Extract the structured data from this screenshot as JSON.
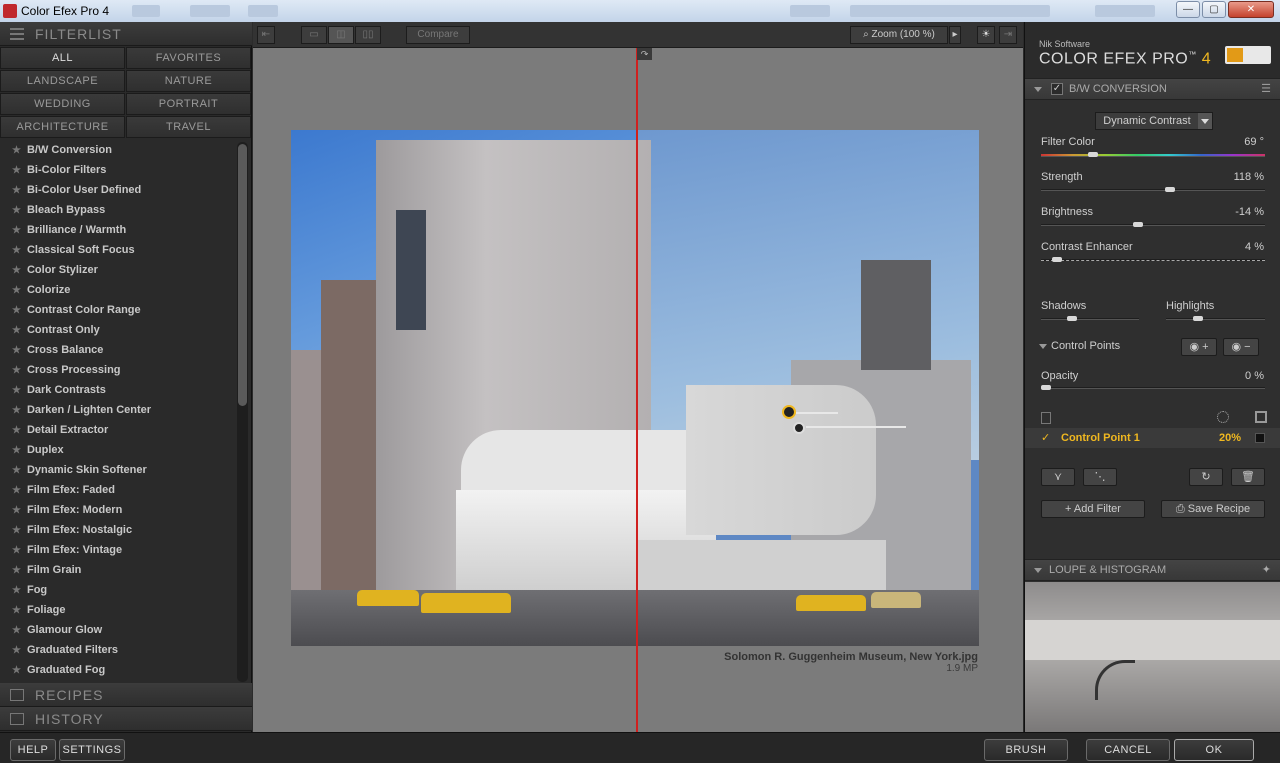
{
  "window": {
    "title": "Color Efex Pro 4",
    "buttons": {
      "minimize": "—",
      "maximize": "▢",
      "close": "✕"
    }
  },
  "left": {
    "filterlist_header": "FILTERLIST",
    "categories": [
      [
        "ALL",
        "FAVORITES"
      ],
      [
        "LANDSCAPE",
        "NATURE"
      ],
      [
        "WEDDING",
        "PORTRAIT"
      ],
      [
        "ARCHITECTURE",
        "TRAVEL"
      ]
    ],
    "filters": [
      "B/W Conversion",
      "Bi-Color Filters",
      "Bi-Color User Defined",
      "Bleach Bypass",
      "Brilliance / Warmth",
      "Classical Soft Focus",
      "Color Stylizer",
      "Colorize",
      "Contrast Color Range",
      "Contrast Only",
      "Cross Balance",
      "Cross Processing",
      "Dark Contrasts",
      "Darken / Lighten Center",
      "Detail Extractor",
      "Duplex",
      "Dynamic Skin Softener",
      "Film Efex: Faded",
      "Film Efex: Modern",
      "Film Efex: Nostalgic",
      "Film Efex: Vintage",
      "Film Grain",
      "Fog",
      "Foliage",
      "Glamour Glow",
      "Graduated Filters",
      "Graduated Fog"
    ],
    "recipes_header": "RECIPES",
    "history_header": "HISTORY",
    "star": "★"
  },
  "toolbar": {
    "compare": "Compare",
    "zoom": "Zoom (100 %)",
    "zoom_arrow": "▸"
  },
  "canvas": {
    "filename": "Solomon R. Guggenheim Museum, New York.jpg",
    "size": "1.9 MP"
  },
  "right": {
    "brand_small": "Nik Software",
    "brand_name": "COLOR EFEX PRO",
    "brand_tm": "™",
    "brand_version": "4",
    "section_title": "B/W CONVERSION",
    "method": "Dynamic Contrast",
    "sliders": [
      {
        "label": "Filter Color",
        "value": "69",
        "unit": "°",
        "fraction": 0.22
      },
      {
        "label": "Strength",
        "value": "118",
        "unit": "%",
        "fraction": 0.58
      },
      {
        "label": "Brightness",
        "value": "-14",
        "unit": "%",
        "fraction": 0.43
      },
      {
        "label": "Contrast Enhancer",
        "value": "4",
        "unit": "%",
        "fraction": 0.05
      }
    ],
    "shadows": {
      "label": "Shadows",
      "fraction": 0.3
    },
    "highlights": {
      "label": "Highlights",
      "fraction": 0.3
    },
    "control_points_label": "Control Points",
    "opacity": {
      "label": "Opacity",
      "value": "0",
      "unit": "%",
      "fraction": 0.0
    },
    "control_point": {
      "name": "Control Point 1",
      "value": "20%",
      "check": "✓"
    },
    "add_filter": "Add Filter",
    "save_recipe": "Save Recipe",
    "loupe_header": "LOUPE & HISTOGRAM"
  },
  "bottom": {
    "help": "HELP",
    "settings": "SETTINGS",
    "brush": "BRUSH",
    "cancel": "CANCEL",
    "ok": "OK"
  },
  "colors": {
    "accent": "#f0b820",
    "split_line": "#d0201f"
  }
}
